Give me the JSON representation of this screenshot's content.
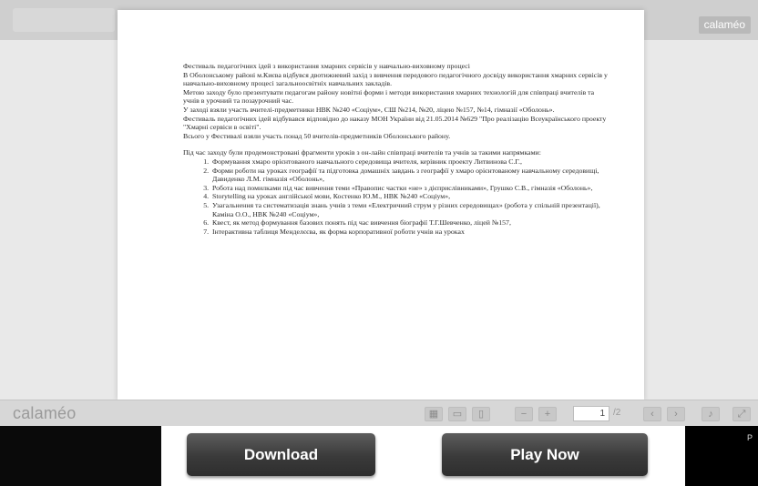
{
  "viewer": {
    "brand_badge": "calaméo",
    "logo": "calaméo",
    "current_page": "1",
    "page_total": "/2"
  },
  "document": {
    "paragraphs": [
      "Фестиваль педагогічних ідей з використання хмарних сервісів у навчально-виховному процесі",
      "В Оболонському районі м.Києва відбувся двотижневий захід з вивчення передового педагогічного досвіду використання хмарних сервісів у навчально-виховному процесі загальноосвітніх навчальних закладів.",
      "Метою заходу було презентувати педагогам району новітні форми і методи використання хмарних технологій для співпраці вчителів та учнів в урочний та позаурочний час.",
      "У заході взяли участь вчителі-предметники НВК №240 «Соціум», СШ №214, №20, ліцею №157, №14, гімназії «Оболонь».",
      "Фестиваль педагогічних ідей відбувався відповідно до наказу МОН України від 21.05.2014 №629 \"Про реалізацію Всеукраїнського проекту \"Хмарні сервіси в освіті\".",
      "Всього у Фестивалі взяли участь понад 50 вчителів-предметників Оболонського району."
    ],
    "list_intro": "Під час заходу були продемонстровані фрагменти уроків з он-лайн співпраці вчителів та учнів за такими напрямками:",
    "list_items": [
      "Формування хмаро орієнтованого навчального середовища вчителя, керівник проекту Литвинова С.Г.,",
      "Форми роботи на уроках географії та підготовка домашніх завдань з географії у хмаро орієнтованому навчальному середовищі, Давиденко Л.М. гімназія «Оболонь»,",
      "Робота над помилками під час вивчення теми «Правопис частки «не» з дієприслівниками», Грушко С.В., гімназія «Оболонь»,",
      "Storytelling на уроках англійської мови, Костенко Ю.М., НВК №240 «Соціум»,",
      "Узагальнення та систематизація знань учнів з теми «Електричний струм у різних середовищах» (робота у спільній презентації), Каміна О.О., НВК №240 «Соціум»,",
      "Квест, як метод формування базових понять під час вивчення біографії Т.Г.Шевченко, ліцей №157,",
      "Інтерактивна таблиця Менделєєва, як форма корпоративної роботи учнів на уроках"
    ]
  },
  "toolbar": {
    "icons": [
      "thumbnails-icon",
      "single-page-icon",
      "double-page-icon",
      "zoom-out-icon",
      "zoom-in-icon",
      "previous-page-icon",
      "next-page-icon",
      "sound-icon",
      "fullscreen-icon"
    ]
  },
  "ad": {
    "download_label": "Download",
    "play_label": "Play Now",
    "corner_label": "P"
  }
}
